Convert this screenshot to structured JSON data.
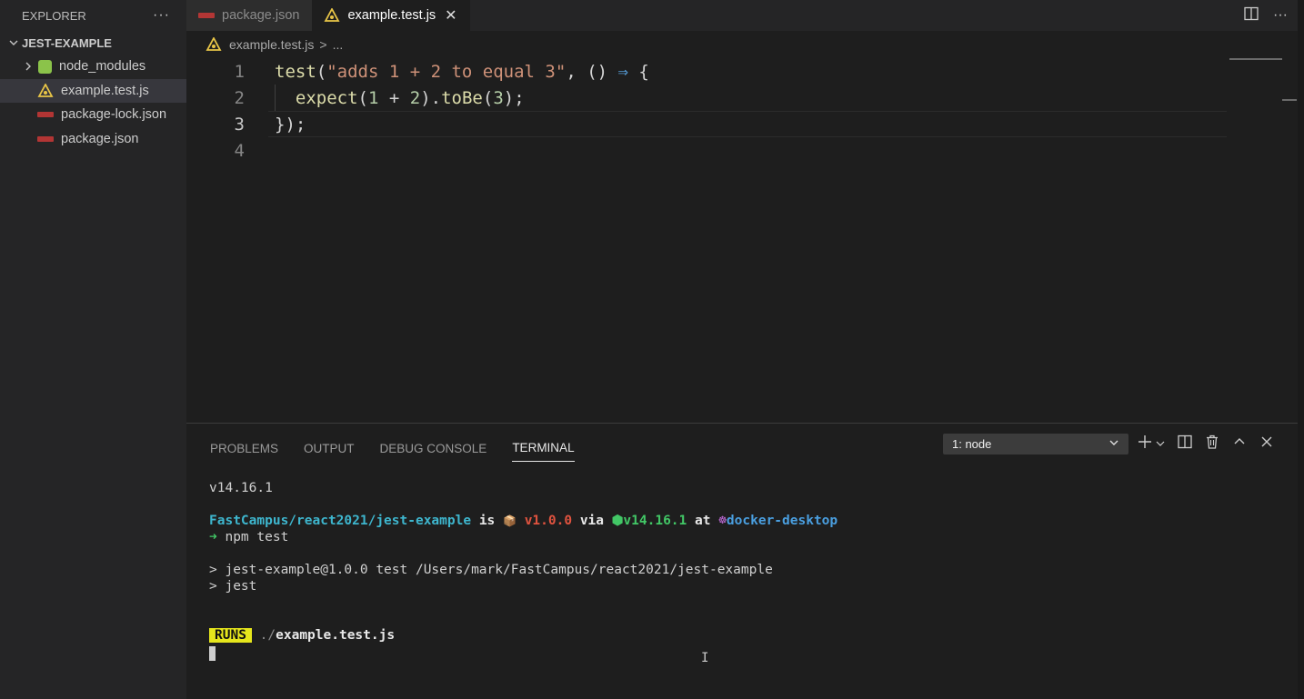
{
  "sidebar": {
    "title": "EXPLORER",
    "more": "···",
    "folder": "JEST-EXAMPLE",
    "items": [
      {
        "label": "node_modules",
        "icon": "node-modules-folder-icon",
        "type": "folder"
      },
      {
        "label": "example.test.js",
        "icon": "jest-icon",
        "type": "file",
        "selected": true
      },
      {
        "label": "package-lock.json",
        "icon": "npm-icon",
        "type": "file"
      },
      {
        "label": "package.json",
        "icon": "npm-icon",
        "type": "file"
      }
    ]
  },
  "tabs": [
    {
      "label": "package.json",
      "icon": "npm-icon",
      "active": false
    },
    {
      "label": "example.test.js",
      "icon": "jest-icon",
      "active": true,
      "close": "✕"
    }
  ],
  "tab_actions": {
    "split": "split-editor-icon",
    "more": "···"
  },
  "breadcrumb": {
    "file": "example.test.js",
    "sep": ">",
    "rest": "..."
  },
  "editor": {
    "lines": [
      {
        "num": "1",
        "parts": [
          [
            "fn",
            "test"
          ],
          [
            "p",
            "("
          ],
          [
            "str",
            "\"adds 1 + 2 to equal 3\""
          ],
          [
            "p",
            ", () "
          ],
          [
            "arrow",
            "⇒"
          ],
          [
            "p",
            " {"
          ]
        ]
      },
      {
        "num": "2",
        "parts": [
          [
            "p",
            "  "
          ],
          [
            "fn",
            "expect"
          ],
          [
            "p",
            "("
          ],
          [
            "num",
            "1"
          ],
          [
            "p",
            " + "
          ],
          [
            "num",
            "2"
          ],
          [
            "p",
            ")."
          ],
          [
            "fn",
            "toBe"
          ],
          [
            "p",
            "("
          ],
          [
            "num",
            "3"
          ],
          [
            "p",
            ");"
          ]
        ]
      },
      {
        "num": "3",
        "parts": [
          [
            "p",
            "});"
          ]
        ]
      },
      {
        "num": "4",
        "parts": []
      }
    ]
  },
  "panel": {
    "tabs": [
      "PROBLEMS",
      "OUTPUT",
      "DEBUG CONSOLE",
      "TERMINAL"
    ],
    "active_tab": "TERMINAL",
    "terminal_select": "1: node",
    "actions": {
      "add": "+",
      "chevron": "⌄",
      "split": "split-terminal-icon",
      "trash": "trash-icon",
      "maximize": "^",
      "close": "✕"
    }
  },
  "terminal": {
    "node_version": "v14.16.1",
    "prompt_path": "FastCampus/react2021/jest-example",
    "is": " is ",
    "pkg_icon": "📦",
    "pkg_version": "v1.0.0",
    "via": " via ",
    "node_icon": "⬢",
    "node_ver": "v14.16.1",
    "at": " at ",
    "docker_icon": "☸",
    "docker": "docker-desktop",
    "prompt_arrow": "➜",
    "command": "npm test",
    "script_line1": "> jest-example@1.0.0 test /Users/mark/FastCampus/react2021/jest-example",
    "script_line2": "> jest",
    "runs_badge": "RUNS",
    "runs_dir": "./",
    "runs_file": "example.test.js",
    "ibeam": "I"
  },
  "colors": {
    "accent_cyan": "#3eb6ce",
    "version_red": "#e0533f",
    "node_green": "#42c766",
    "docker_blue": "#4a9fe0",
    "runs_yellow": "#e6e61c"
  }
}
